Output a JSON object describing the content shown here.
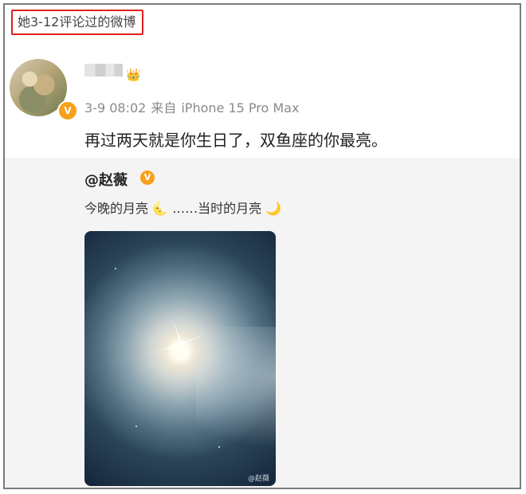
{
  "header": {
    "label": "她3-12评论过的微博",
    "highlight_color": "#e0201c"
  },
  "post": {
    "avatar_icon": "avatar",
    "verify_icon": "verified-v-icon",
    "verify_glyph": "V",
    "badge_icon": "crown-icon",
    "badge_glyph": "👑",
    "meta": {
      "time": "3-9 08:02",
      "source_prefix": "来自",
      "source": "iPhone 15 Pro Max"
    },
    "text": "再过两天就是你生日了，双鱼座的你最亮。"
  },
  "repost": {
    "author": "@赵薇",
    "verify_glyph": "V",
    "text_part1": "今晚的月亮",
    "moon1": "🌜",
    "text_part2": "……当时的月亮",
    "moon2": "🌙",
    "photo_watermark": "@赵薇"
  },
  "colors": {
    "verify_badge": "#f7a11a",
    "repost_background": "#f4f4f4",
    "meta_text": "#8a8a8a"
  }
}
